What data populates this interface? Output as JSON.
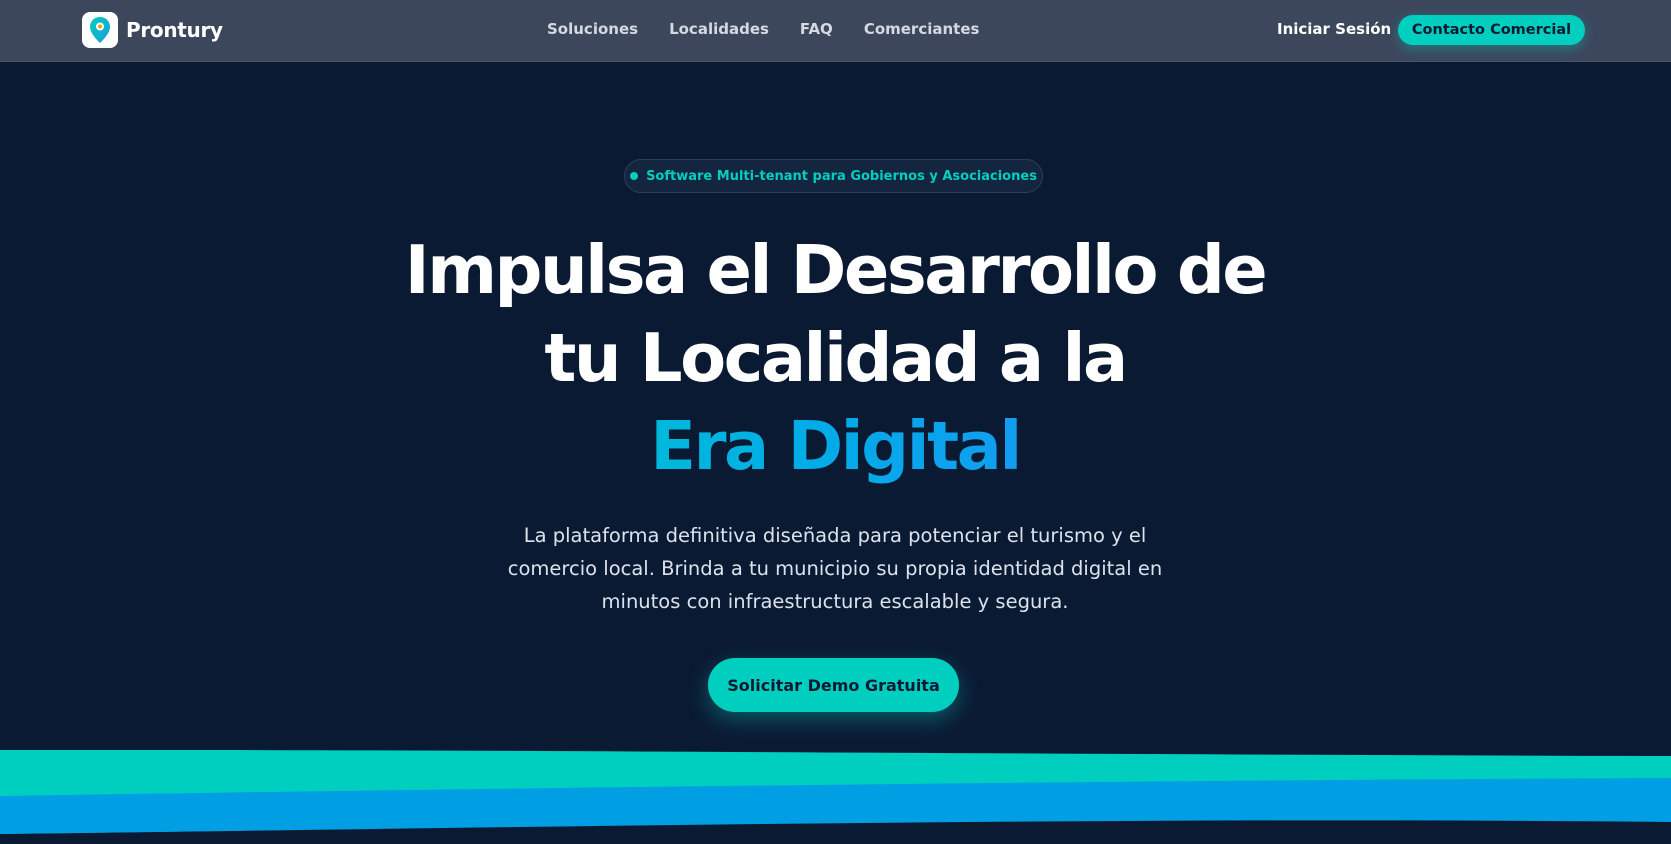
{
  "nav": {
    "brand": "Prontury",
    "links": [
      "Soluciones",
      "Localidades",
      "FAQ",
      "Comerciantes"
    ],
    "login": "Iniciar Sesión",
    "contact": "Contacto Comercial"
  },
  "hero": {
    "badge": "Software Multi-tenant para Gobiernos y Asociaciones",
    "title_line1": "Impulsa el Desarrollo de",
    "title_line2": "tu Localidad a la",
    "title_accent": "Era Digital",
    "subtitle": "La plataforma definitiva diseñada para potenciar el turismo y el comercio local. Brinda a tu municipio su propia identidad digital en minutos con infraestructura escalable y segura.",
    "cta": "Solicitar Demo Gratuita"
  },
  "colors": {
    "background": "#0b1a33",
    "navbar": "#3c475c",
    "accent": "#00cfc0",
    "wave_blue": "#009fe3"
  },
  "icons": {
    "logo": "map-pin-icon"
  }
}
